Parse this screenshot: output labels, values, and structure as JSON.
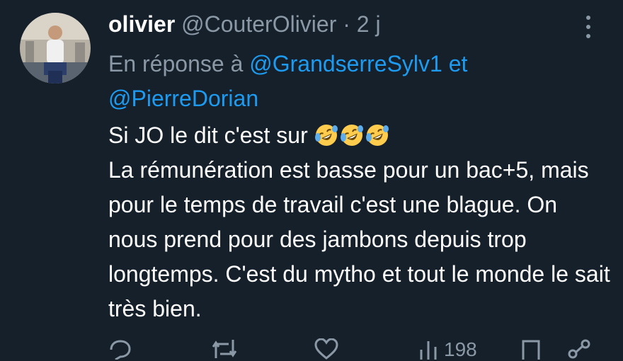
{
  "tweet": {
    "display_name": "olivier",
    "handle": "@CouterOlivier",
    "separator": "·",
    "time": "2 j",
    "reply_prefix": "En réponse à",
    "reply_mention_1": "@GrandserreSylv1",
    "reply_conjunction": "et",
    "reply_mention_2": "@PierreDorian",
    "text_line_first": "Si JO le dit c'est sur",
    "text_emoji": "rolling-on-floor-laughing x3",
    "text_body": "La rémunération est basse pour un bac+5, mais pour le temps de travail c'est une blague. On nous prend pour des jambons depuis trop longtemps. C'est du mytho et tout le monde le sait très bien.",
    "views_count": "198"
  },
  "colors": {
    "background": "#15202b",
    "primary_text": "#ffffff",
    "secondary_text": "#8b98a5",
    "link": "#1d9bf0"
  }
}
